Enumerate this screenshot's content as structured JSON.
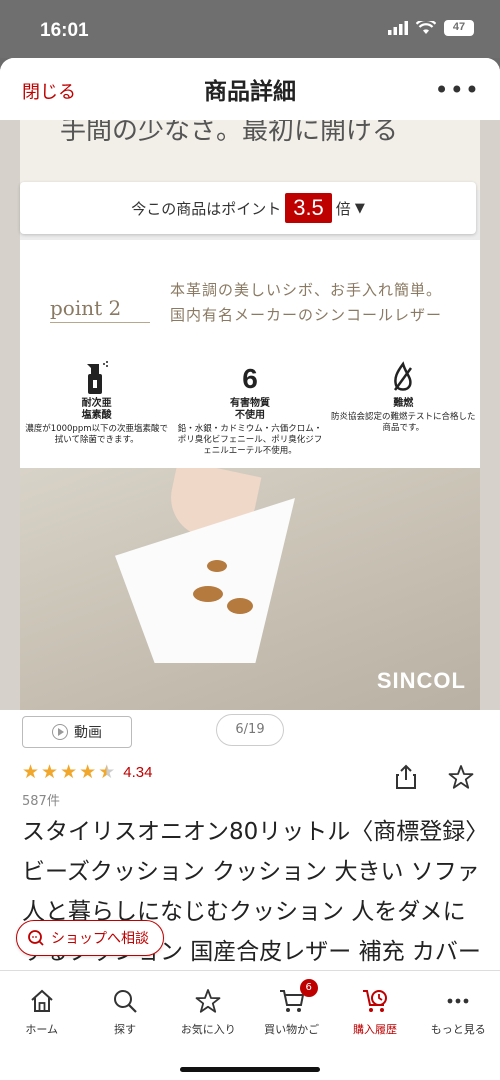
{
  "status_bar": {
    "time": "16:01",
    "battery": "47"
  },
  "header": {
    "close_label": "閉じる",
    "title": "商品詳細",
    "more_label": "•••"
  },
  "points_banner": {
    "prefix": "今この商品はポイント",
    "value": "3.5",
    "suffix": "倍"
  },
  "slide": {
    "prev_text": "手間の少なさ。最初に開ける",
    "point_label": "point 2",
    "headline_line1": "本革調の美しいシボ、お手入れ簡単。",
    "headline_line2": "国内有名メーカーのシンコールレザー",
    "features": [
      {
        "title_line1": "耐次亜",
        "title_line2": "塩素酸",
        "desc": "濃度が1000ppm以下の次亜塩素酸で拭いて除菌できます。",
        "icon": "spray-bottle-icon"
      },
      {
        "title_line1": "有害物質",
        "title_line2": "不使用",
        "desc": "鉛・水銀・カドミウム・六価クロム・ポリ臭化ビフェニール、ポリ臭化ジフェニルエーテル不使用。",
        "icon": "six-icon"
      },
      {
        "title_line1": "難燃",
        "title_line2": "",
        "desc": "防炎協会認定の難燃テストに合格した商品です。",
        "icon": "flame-retardant-icon"
      }
    ],
    "brand": "SINCOL"
  },
  "media": {
    "video_label": "動画",
    "page_counter": "6/19"
  },
  "product": {
    "rating": "4.34",
    "rating_stars": 4.5,
    "review_count": "587件",
    "title": "スタイリスオニオン80リットル〈商標登録〉ビーズクッション クッション 大きい ソファ 人と暮らしになじむクッション 人をダメにするクッション 国産合皮レザー 補充 カバー 日本製 おうち時間"
  },
  "shop_consult_label": "ショップへ相談",
  "tabs": [
    {
      "label": "ホーム",
      "icon": "home-icon"
    },
    {
      "label": "探す",
      "icon": "search-icon"
    },
    {
      "label": "お気に入り",
      "icon": "star-icon"
    },
    {
      "label": "買い物かご",
      "icon": "cart-icon",
      "badge": "6"
    },
    {
      "label": "購入履歴",
      "icon": "history-icon",
      "active": true
    },
    {
      "label": "もっと見る",
      "icon": "more-icon"
    }
  ],
  "colors": {
    "accent": "#bf0000",
    "star": "#f1a72c"
  }
}
